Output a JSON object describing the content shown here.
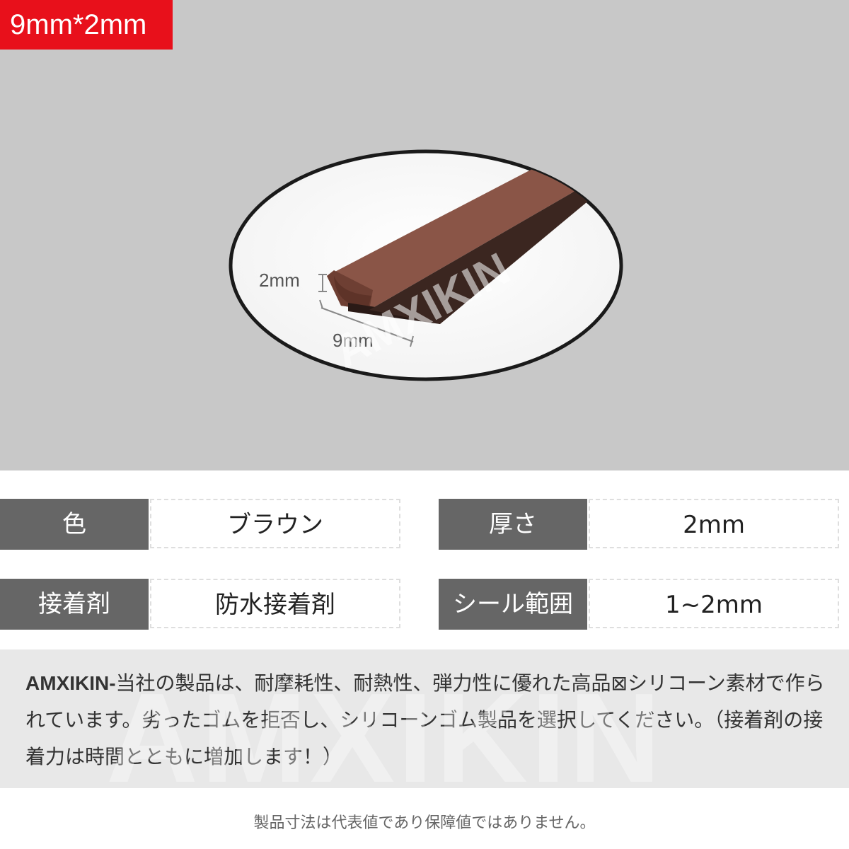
{
  "badge": {
    "size": "9mm*2mm"
  },
  "photo": {
    "watermark": "AMXIKIN",
    "dim_thickness": "2mm",
    "dim_width": "9mm",
    "strip_color": "#7b4a3c"
  },
  "specs": [
    {
      "label": "色",
      "value": "ブラウン"
    },
    {
      "label": "厚さ",
      "value": "2mm"
    },
    {
      "label": "接着剤",
      "value": "防水接着剤"
    },
    {
      "label": "シール範囲",
      "value": "1~2mm"
    }
  ],
  "description": {
    "brand": "AMXIKIN-",
    "text": "当社の製品は、耐摩耗性、耐熱性、弾力性に優れた高品⊠シリコーン素材で作られています。劣ったゴムを拒否し、シリコーンゴム製品を選択してください。（接着剤の接着力は時間とともに増加します！）"
  },
  "watermark_text": "AMXIKIN",
  "note": "製品寸法は代表値であり保障値ではありません。",
  "colors": {
    "badge": "#e8101b",
    "label_bg": "#666666",
    "hero_bg": "#c8c8c8",
    "desc_bg": "#e8e8e8"
  }
}
